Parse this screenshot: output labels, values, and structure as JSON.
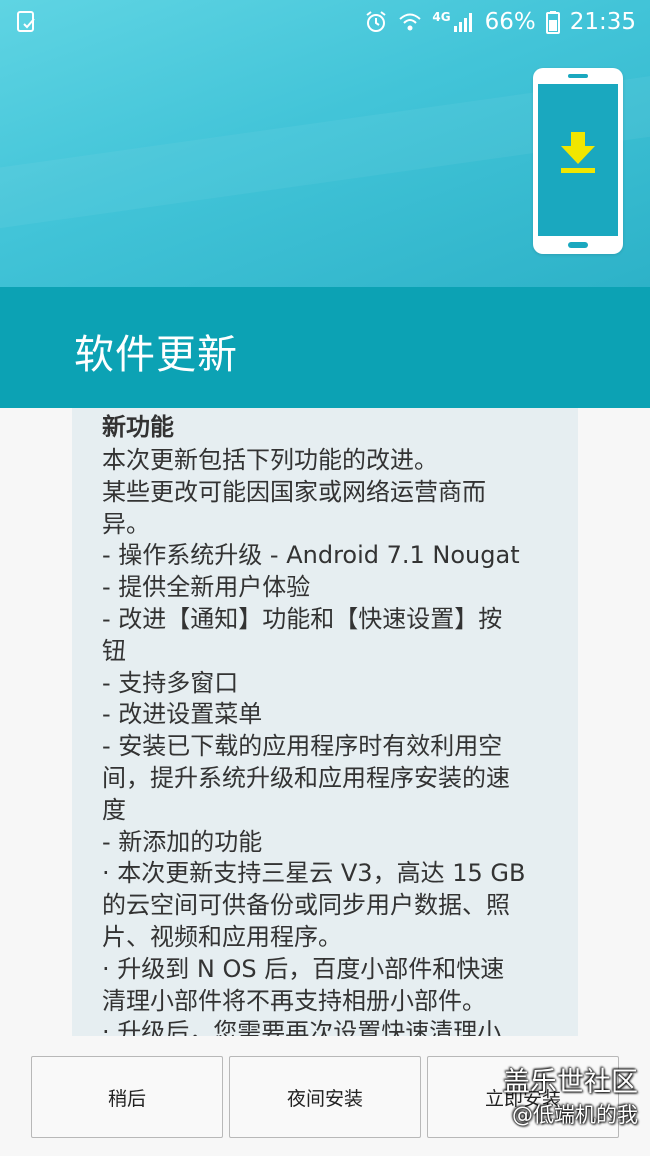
{
  "status_bar": {
    "battery_percent": "66%",
    "time": "21:35",
    "network": "4G",
    "icons": [
      "screenshot-icon",
      "alarm-icon",
      "wifi-icon",
      "signal-icon",
      "battery-icon"
    ]
  },
  "header": {
    "title": "软件更新",
    "colors": {
      "top": "#42c4d8",
      "bottom": "#0ca2b4",
      "arrow": "#f1e600"
    }
  },
  "notes": {
    "heading": "新功能",
    "lines": [
      "本次更新包括下列功能的改进。",
      "某些更改可能因国家或网络运营商而",
      "异。",
      "- 操作系统升级 - Android 7.1 Nougat",
      "- 提供全新用户体验",
      "- 改进【通知】功能和【快速设置】按",
      "钮",
      "- 支持多窗口",
      "- 改进设置菜单",
      "- 安装已下载的应用程序时有效利用空",
      "间，提升系统升级和应用程序安装的速",
      "度",
      "- 新添加的功能",
      "· 本次更新支持三星云 V3，高达 15 GB",
      "的云空间可供备份或同步用户数据、照",
      "片、视频和应用程序。",
      "· 升级到 N OS 后，百度小部件和快速",
      "清理小部件将不再支持相册小部件。",
      "· 升级后，您需要再次设置快速清理小"
    ]
  },
  "buttons": {
    "later": "稍后",
    "night": "夜间安装",
    "now": "立即安装"
  },
  "watermark": {
    "line1": "盖乐世社区",
    "line2": "@低端机的我"
  }
}
